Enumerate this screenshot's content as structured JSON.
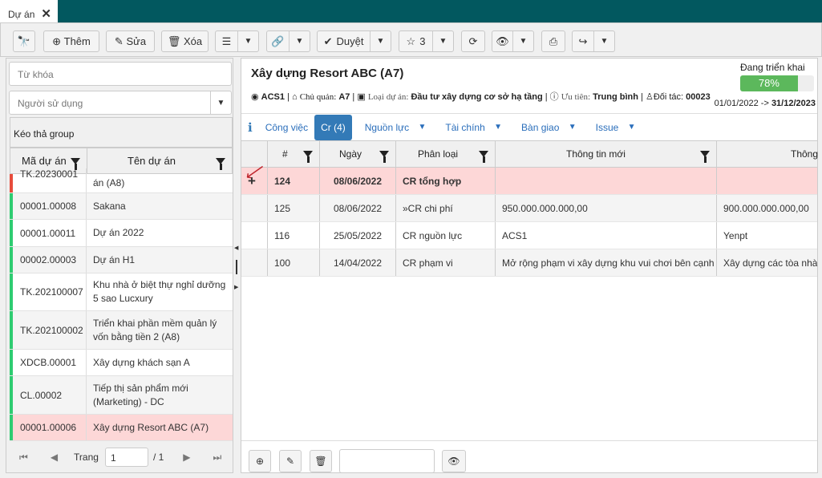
{
  "tab": {
    "label": "Dự án",
    "close": "✕"
  },
  "toolbar": {
    "add": "Thêm",
    "edit": "Sửa",
    "delete": "Xóa",
    "approve": "Duyệt",
    "star_count": "3"
  },
  "left": {
    "keyword_placeholder": "Từ khóa",
    "user_placeholder": "Người sử dụng",
    "group_hint": "Kéo thả group",
    "columns": [
      "Mã dự án",
      "Tên dự án"
    ],
    "rows": [
      {
        "code": "TK.20230001",
        "name": "án (A8)",
        "status": "#e74c3c"
      },
      {
        "code": "00001.00008",
        "name": "Sakana",
        "status": "#2ecc71"
      },
      {
        "code": "00001.00011",
        "name": "Dự án 2022",
        "status": "#2ecc71"
      },
      {
        "code": "00002.00003",
        "name": "Dự án H1",
        "status": "#2ecc71"
      },
      {
        "code": "TK.202100007",
        "name": "Khu nhà ở biệt thự nghỉ dưỡng 5 sao Lucxury",
        "status": "#2ecc71"
      },
      {
        "code": "TK.202100002",
        "name": "Triển khai phần mềm quản lý vốn bằng tiền 2 (A8)",
        "status": "#2ecc71"
      },
      {
        "code": "XDCB.00001",
        "name": "Xây dựng khách sạn A",
        "status": "#2ecc71"
      },
      {
        "code": "CL.00002",
        "name": "Tiếp thị sản phẩm mới (Marketing) - DC",
        "status": "#2ecc71"
      },
      {
        "code": "00001.00006",
        "name": "Xây dựng Resort ABC (A7)",
        "status": "#2ecc71"
      }
    ],
    "pager": {
      "label": "Trang",
      "page": "1",
      "total": "/ 1"
    }
  },
  "project": {
    "title": "Xây dựng Resort ABC (A7)",
    "status": "Đang triển khai",
    "progress": 78,
    "progress_text": "78%",
    "owner": "ACS1",
    "manager_label": "Chủ quản:",
    "manager": "A7",
    "type_label": "Loại dự án:",
    "type": "Đầu tư xây dựng cơ sở hạ tầng",
    "priority_label": "Ưu tiên:",
    "priority": "Trung bình",
    "partner_label": "Đối tác:",
    "partner": "00023",
    "date_start": "01/01/2022",
    "date_sep": " -> ",
    "date_end": "31/12/2023"
  },
  "tabs": [
    "Công việc",
    "Cr (4)",
    "Nguồn lực",
    "Tài chính",
    "Bàn giao",
    "Issue"
  ],
  "grid": {
    "columns": [
      "#",
      "Ngày",
      "Phân loại",
      "Thông tin mới",
      "Thông"
    ],
    "rows": [
      {
        "id": "124",
        "date": "08/06/2022",
        "type": "CR tổng hợp",
        "new": "",
        "old": ""
      },
      {
        "id": "125",
        "date": "08/06/2022",
        "type": "»CR chi phí",
        "new": "950.000.000.000,00",
        "old": "900.000.000.000,00"
      },
      {
        "id": "116",
        "date": "25/05/2022",
        "type": "CR nguồn lực",
        "new": "ACS1",
        "old": "Yenpt"
      },
      {
        "id": "100",
        "date": "14/04/2022",
        "type": "CR phạm vi",
        "new": "Mở rộng phạm vi xây dựng khu vui chơi bên cạnh",
        "old": "Xây dựng các tòa nhà kh"
      }
    ]
  },
  "colors": {
    "teal": "#02585f",
    "selected": "#fdd7d7",
    "accent": "#337ab7",
    "progress": "#5cb85c"
  }
}
